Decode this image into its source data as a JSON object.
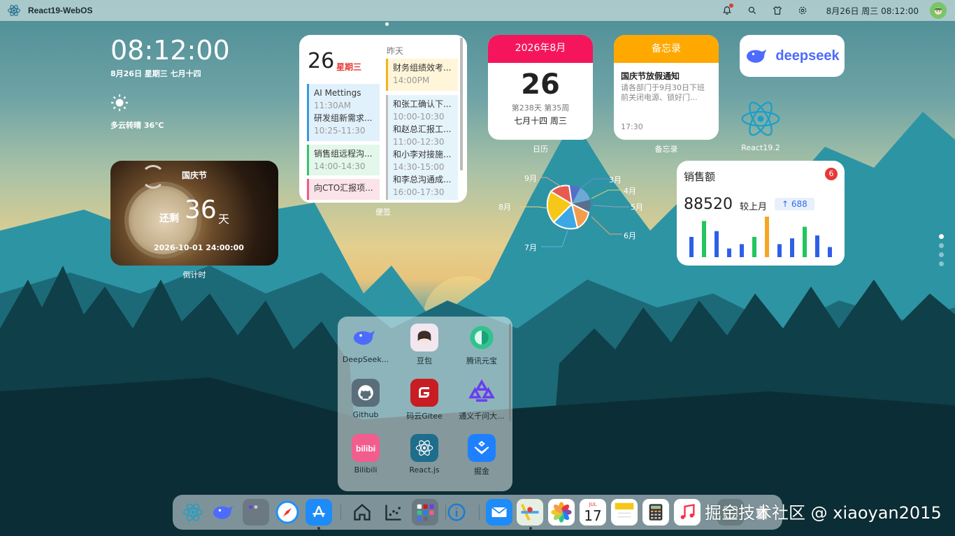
{
  "topbar": {
    "app_title": "React19-WebOS",
    "datetime": "8月26日 周三 08:12:00",
    "icons": [
      "react-logo-icon",
      "bell-icon",
      "search-icon",
      "shirt-icon",
      "gear-icon",
      "avatar"
    ]
  },
  "clock": {
    "time": "08:12:00",
    "date": "8月26日 星期三 七月十四",
    "weather": "多云转晴 36℃"
  },
  "countdown": {
    "title": "国庆节",
    "rest": "还剩",
    "days": "36",
    "unit": "天",
    "target": "2026-10-01 24:00:00",
    "label": "倒计时"
  },
  "schedule": {
    "day": "26",
    "weekday": "星期三",
    "yesterday": "昨天",
    "today_events": [
      {
        "title": "AI Mettings",
        "time": "11:30AM",
        "title2": "研发组新需求...",
        "time2": "10:25-11:30"
      },
      {
        "title": "销售组远程沟...",
        "time": "14:00-14:30"
      },
      {
        "title": "向CTO汇报项..."
      }
    ],
    "yesterday_events": [
      {
        "title": "财务组绩效考...",
        "time": "14:00PM"
      },
      {
        "title": "和张工确认下...",
        "time": "10:00-10:30"
      },
      {
        "title": "和赵总汇报工...",
        "time": "11:00-12:30"
      },
      {
        "title": "和小李对接施...",
        "time": "14:30-15:00"
      },
      {
        "title": "和李总沟通成...",
        "time": "16:00-17:30"
      }
    ],
    "label": "便签"
  },
  "calendar": {
    "header": "2026年8月",
    "day": "26",
    "sub": "第238天 第35周",
    "lunar": "七月十四 周三",
    "label": "日历"
  },
  "memo": {
    "header": "备忘录",
    "title": "国庆节放假通知",
    "body": "请各部门于9月30日下班前关闭电源、锁好门...",
    "time": "17:30",
    "label": "备忘录"
  },
  "deepseek": {
    "text": "deepseek"
  },
  "react_shortcut": {
    "label": "React19.2"
  },
  "pie": {
    "months": [
      "9月",
      "3月",
      "4月",
      "8月",
      "5月",
      "6月",
      "7月"
    ]
  },
  "sales": {
    "title": "销售额",
    "badge": "6",
    "value": "88520",
    "compare": "较上月",
    "delta": "688",
    "bars": [
      {
        "v": 28,
        "c": "#2f5fe8"
      },
      {
        "v": 50,
        "c": "#22c55e"
      },
      {
        "v": 36,
        "c": "#2f5fe8"
      },
      {
        "v": 12,
        "c": "#2f5fe8"
      },
      {
        "v": 18,
        "c": "#2f5fe8"
      },
      {
        "v": 28,
        "c": "#22c55e"
      },
      {
        "v": 56,
        "c": "#f5a623"
      },
      {
        "v": 18,
        "c": "#2f5fe8"
      },
      {
        "v": 26,
        "c": "#2f5fe8"
      },
      {
        "v": 42,
        "c": "#22c55e"
      },
      {
        "v": 30,
        "c": "#2f5fe8"
      },
      {
        "v": 14,
        "c": "#2f5fe8"
      }
    ]
  },
  "folder": {
    "apps": [
      {
        "name": "DeepSeek...",
        "icon": "deepseek-icon",
        "color": "#ffffff"
      },
      {
        "name": "豆包",
        "icon": "doubao-icon",
        "color": "#f2e6ef"
      },
      {
        "name": "腾讯元宝",
        "icon": "yuanbao-icon",
        "color": "#ffffff"
      },
      {
        "name": "Github",
        "icon": "github-icon",
        "color": "#5a6e7a"
      },
      {
        "name": "码云Gitee",
        "icon": "gitee-icon",
        "color": "#c71d23"
      },
      {
        "name": "通义千问大...",
        "icon": "tongyi-icon",
        "color": "#ffffff"
      },
      {
        "name": "Bilibili",
        "icon": "bilibili-icon",
        "color": "#f25d8e"
      },
      {
        "name": "React.js",
        "icon": "react-icon",
        "color": "#1f6d8c"
      },
      {
        "name": "掘金",
        "icon": "juejin-icon",
        "color": "#1e80ff"
      }
    ]
  },
  "dock": {
    "items": [
      "react-icon",
      "deepseek-icon",
      "folder-icon",
      "safari-icon",
      "appstore-icon",
      "home-icon",
      "chart-icon",
      "apps-icon",
      "info-icon",
      "mail-icon",
      "maps-icon",
      "photos-icon",
      "calendar-icon",
      "notes-icon",
      "calculator-icon",
      "music-icon",
      "window-icon",
      "trash-icon"
    ],
    "calendar_month": "JUL",
    "calendar_day": "17"
  },
  "watermark": "掘金技术社区 @ xiaoyan2015"
}
